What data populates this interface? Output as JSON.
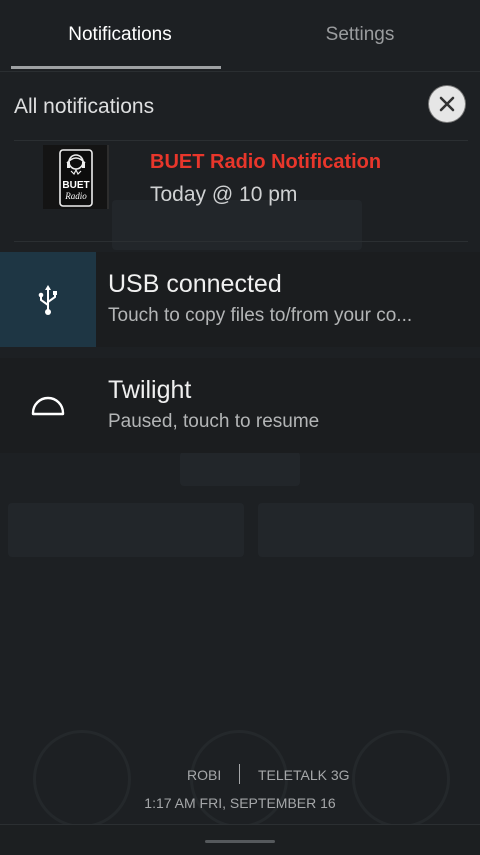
{
  "tabs": {
    "notifications_label": "Notifications",
    "settings_label": "Settings"
  },
  "header": {
    "title": "All notifications",
    "clear_icon": "close-icon"
  },
  "notifications": {
    "buet": {
      "title": "BUET Radio Notification",
      "subtitle": "Today @ 10 pm",
      "logo_text_1": "BUET",
      "logo_text_2": "Radio",
      "title_color": "#e8362b"
    },
    "usb": {
      "icon": "usb-icon",
      "title": "USB connected",
      "subtitle": "Touch to copy files to/from your co..."
    },
    "twilight": {
      "icon": "twilight-icon",
      "title": "Twilight",
      "subtitle": "Paused, touch to resume"
    }
  },
  "carriers": {
    "sim1": "ROBI",
    "sim2": "TELETALK 3G"
  },
  "datetime": "1:17 AM  FRI, SEPTEMBER 16",
  "colors": {
    "shade_bg": "#1d2023",
    "usb_icon_bg": "#1e3644",
    "accent_red": "#e8362b"
  }
}
